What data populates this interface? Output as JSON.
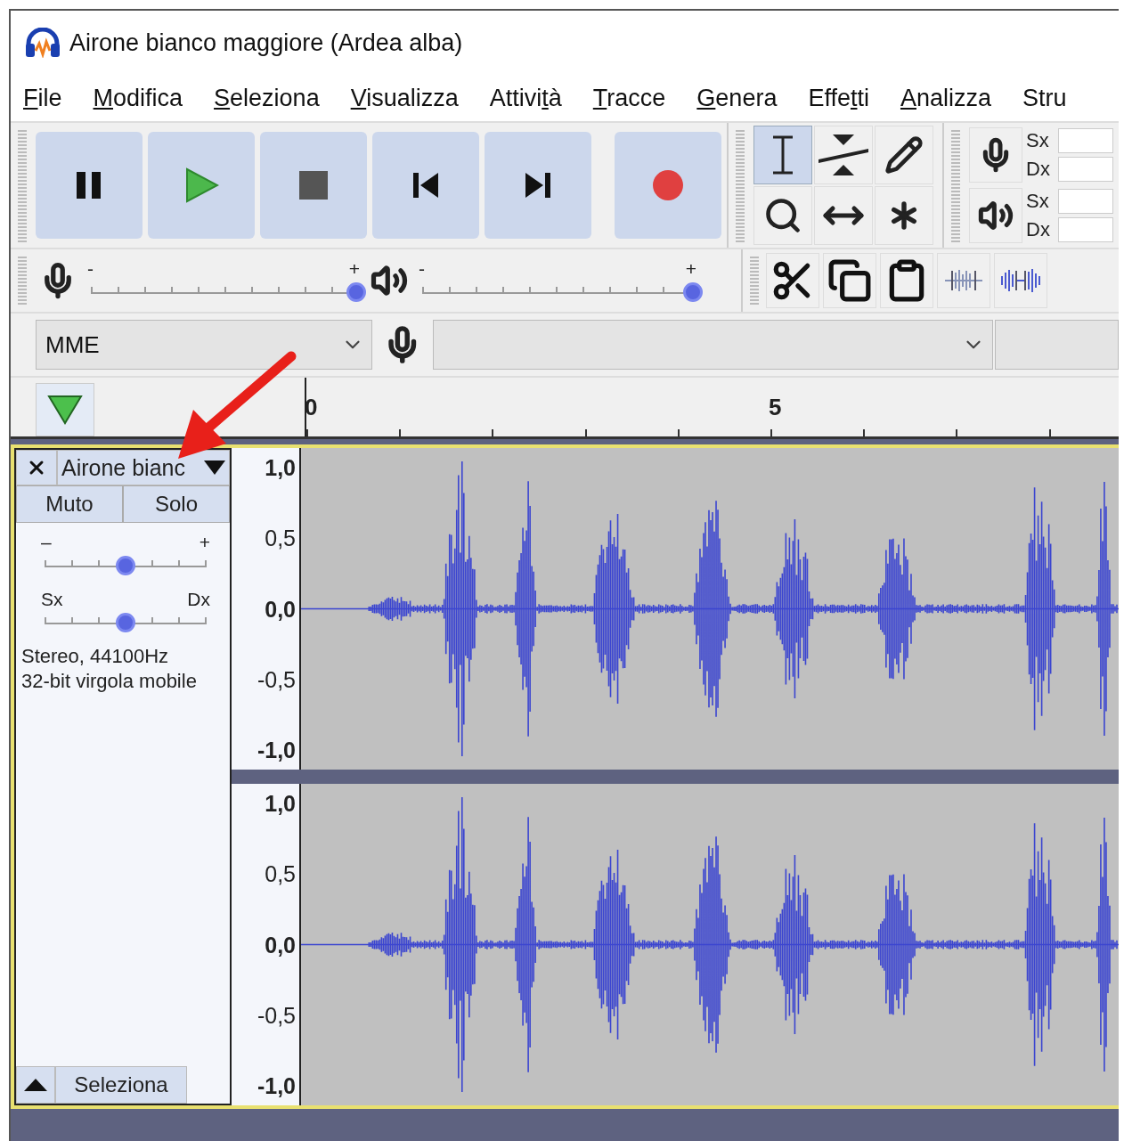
{
  "window": {
    "title": "Airone bianco maggiore (Ardea alba)"
  },
  "menu": [
    {
      "key": "F",
      "after": "ile"
    },
    {
      "key": "M",
      "after": "odifica"
    },
    {
      "key": "S",
      "after": "eleziona"
    },
    {
      "key": "V",
      "after": "isualizza"
    },
    {
      "before": "Attivi",
      "key": "t",
      "after": "à"
    },
    {
      "key": "T",
      "after": "racce"
    },
    {
      "key": "G",
      "after": "enera"
    },
    {
      "before": "Effe",
      "key": "t",
      "after": "ti"
    },
    {
      "key": "A",
      "after": "nalizza"
    },
    {
      "before": "Stru"
    }
  ],
  "transport": [
    {
      "kind": "pause"
    },
    {
      "kind": "play"
    },
    {
      "kind": "stop"
    },
    {
      "kind": "skip-start"
    },
    {
      "kind": "skip-end"
    },
    {
      "kind": "record"
    }
  ],
  "tools": [
    {
      "kind": "select",
      "selected": true
    },
    {
      "kind": "envelope",
      "selected": false
    },
    {
      "kind": "draw",
      "selected": false
    },
    {
      "kind": "zoom",
      "selected": false
    },
    {
      "kind": "time-shift",
      "selected": false
    },
    {
      "kind": "multi",
      "selected": false
    }
  ],
  "meters": [
    {
      "kind": "record",
      "channels": [
        "Sx",
        "Dx"
      ]
    },
    {
      "kind": "play",
      "channels": [
        "Sx",
        "Dx"
      ]
    }
  ],
  "mixer": [
    {
      "kind": "record",
      "min": "-",
      "max": "+",
      "level": 1
    },
    {
      "kind": "play",
      "min": "-",
      "max": "+",
      "level": 1
    }
  ],
  "edit_tools": [
    {
      "kind": "cut"
    },
    {
      "kind": "copy"
    },
    {
      "kind": "paste"
    },
    {
      "kind": "trim"
    },
    {
      "kind": "silence"
    }
  ],
  "device": {
    "host": "MME"
  },
  "timeline": {
    "labels": [
      "0",
      "5"
    ]
  },
  "track": {
    "name": "Airone bianc",
    "buttons": [
      {
        "label": "Muto",
        "selected": false
      },
      {
        "label": "Solo",
        "selected": false
      }
    ],
    "gain": {
      "min": "–",
      "max": "+",
      "level": 0.5
    },
    "pan": {
      "min": "Sx",
      "max": "Dx",
      "level": 0.5
    },
    "info": [
      "Stereo, 44100Hz",
      "32-bit virgola mobile"
    ],
    "select_button": "Seleziona",
    "channels": [
      {
        "scale": [
          "1,0",
          "0,5",
          "0,0",
          "-0,5",
          "-1,0"
        ]
      },
      {
        "scale": [
          "1,0",
          "0,5",
          "0,0",
          "-0,5",
          "-1,0"
        ]
      }
    ]
  }
}
